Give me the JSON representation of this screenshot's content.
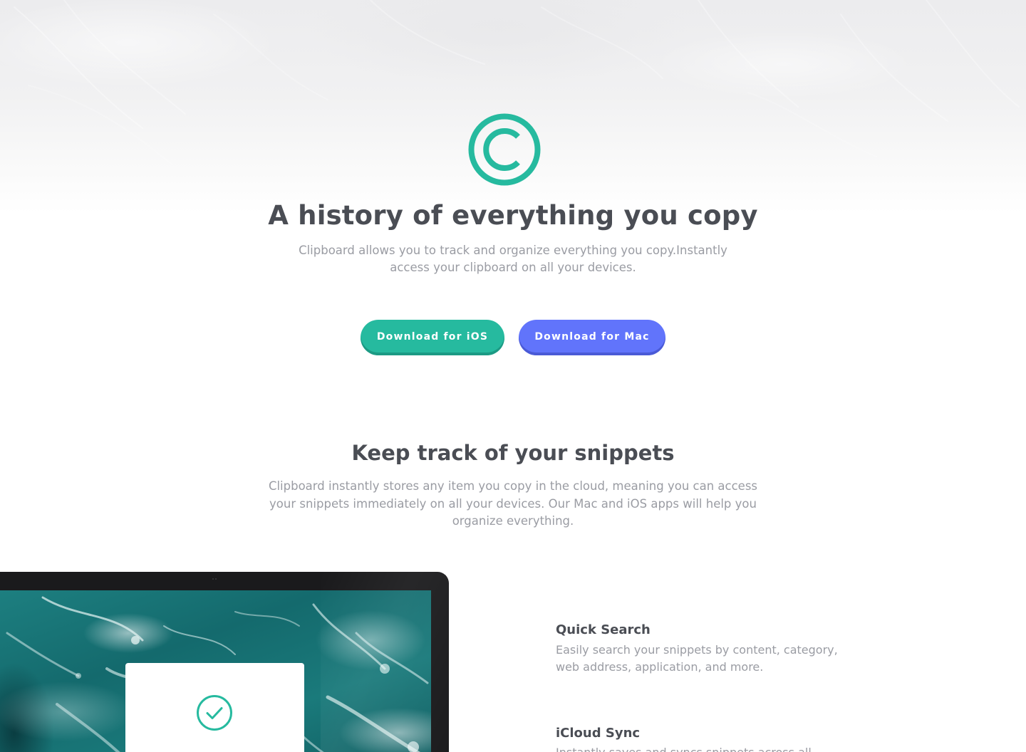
{
  "hero": {
    "logo_icon": "copyright-icon",
    "title": "A history of everything you copy",
    "description": "Clipboard allows you to track and organize everything you copy.Instantly access your clipboard on all your devices.",
    "buttons": {
      "ios_label": "Download for iOS",
      "mac_label": "Download for Mac"
    }
  },
  "snippets": {
    "title": "Keep track of your snippets",
    "description": "Clipboard instantly stores any item you copy in the cloud, meaning you can access your snippets immediately on all your devices. Our Mac and iOS apps will help you organize everything.",
    "card_icon": "check-circle-icon"
  },
  "features": [
    {
      "title": "Quick Search",
      "description": "Easily search your snippets by content, category, web address, application, and more."
    },
    {
      "title": "iCloud Sync",
      "description": "Instantly saves and syncs snippets across all"
    }
  ],
  "colors": {
    "accent_teal": "#26ba9f",
    "accent_blue": "#6174fb",
    "heading": "#4a4d54",
    "body_text": "#9a9ca3"
  }
}
